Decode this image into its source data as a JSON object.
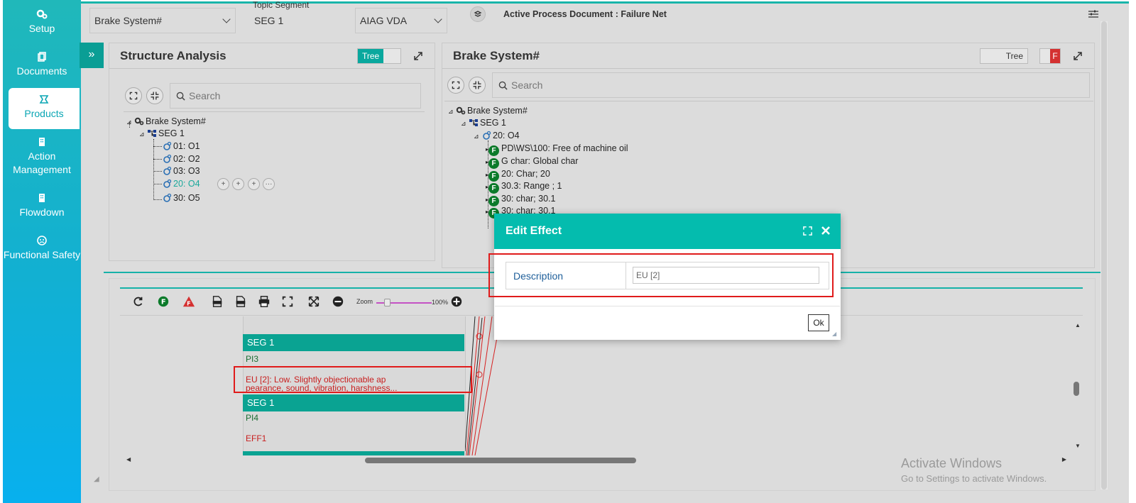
{
  "nav": {
    "items": [
      {
        "label": "Setup",
        "icon": "gears-icon"
      },
      {
        "label": "Documents",
        "icon": "documents-icon"
      },
      {
        "label": "Products",
        "icon": "products-icon"
      },
      {
        "label": "Action Management",
        "icon": "building-icon"
      },
      {
        "label": "Flowdown",
        "icon": "building-icon"
      },
      {
        "label": "Functional Safety",
        "icon": "safety-icon"
      }
    ],
    "active": "Products"
  },
  "topbar": {
    "product_select": "Brake System#",
    "topic_label": "Topic Segment",
    "topic_value": "SEG 1",
    "standard_select": "AIAG VDA",
    "active_doc": "Active Process Document : Failure Net"
  },
  "structure": {
    "title": "Structure Analysis",
    "toggle": "Tree",
    "search_placeholder": "Search",
    "tree": {
      "root": "Brake System#",
      "seg": "SEG 1",
      "ops": [
        "01: O1",
        "02: O2",
        "03: O3",
        "20: O4",
        "30: O5"
      ],
      "selected": "20: O4"
    }
  },
  "brake": {
    "title": "Brake System#",
    "toggle": "Tree",
    "flag": "F",
    "search_placeholder": "Search",
    "tree": {
      "root": "Brake System#",
      "seg": "SEG 1",
      "op": "20: O4",
      "chars": [
        "PD\\WS\\100: Free of machine oil",
        "G char: Global char",
        "20: Char; 20",
        "30.3: Range ; 1",
        "30: char; 30.1",
        "30: char; 30.1"
      ]
    }
  },
  "net": {
    "zoom_label": "Zoom",
    "zoom_value": "100%",
    "cards": [
      {
        "head": "SEG 1",
        "lines": [
          "PI3"
        ]
      },
      {
        "head": "SEG 1",
        "lines": [
          "PI4",
          "EFF1"
        ]
      }
    ],
    "effect_line1": "EU [2]:  Low.  Slightly objectionable ap",
    "effect_line2": "pearance, sound, vibration, harshness..."
  },
  "modal": {
    "title": "Edit Effect",
    "field_label": "Description",
    "field_value": "EU [2]",
    "ok_label": "Ok"
  },
  "watermark": {
    "line1": "Activate Windows",
    "line2": "Go to Settings to activate Windows."
  }
}
